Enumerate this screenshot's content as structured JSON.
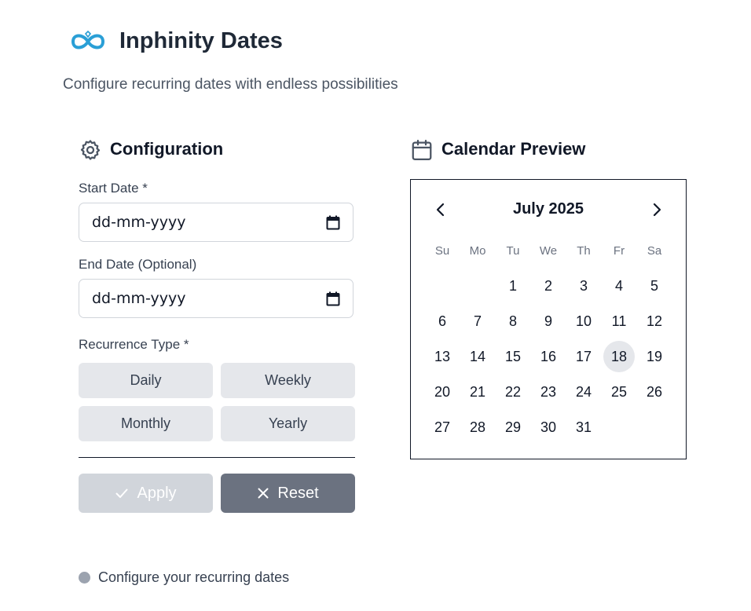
{
  "header": {
    "app_title": "Inphinity Dates",
    "subtitle": "Configure recurring dates with endless possibilities",
    "logo_icon": "infinity-logo-icon",
    "accent_color": "#2a9fd6"
  },
  "config": {
    "title": "Configuration",
    "icon": "gear-icon",
    "start_label": "Start Date *",
    "start_placeholder": "dd-mm-yyyy",
    "end_label": "End Date (Optional)",
    "end_placeholder": "dd-mm-yyyy",
    "recurrence_label": "Recurrence Type *",
    "recurrence_options": [
      "Daily",
      "Weekly",
      "Monthly",
      "Yearly"
    ],
    "apply_label": "Apply",
    "reset_label": "Reset"
  },
  "calendar": {
    "title": "Calendar Preview",
    "icon": "calendar-icon",
    "month_label": "July 2025",
    "weekdays": [
      "Su",
      "Mo",
      "Tu",
      "We",
      "Th",
      "Fr",
      "Sa"
    ],
    "first_weekday_index": 2,
    "days": [
      "1",
      "2",
      "3",
      "4",
      "5",
      "6",
      "7",
      "8",
      "9",
      "10",
      "11",
      "12",
      "13",
      "14",
      "15",
      "16",
      "17",
      "18",
      "19",
      "20",
      "21",
      "22",
      "23",
      "24",
      "25",
      "26",
      "27",
      "28",
      "29",
      "30",
      "31"
    ],
    "selected_day": "18"
  },
  "status": {
    "text": "Configure your recurring dates",
    "dot_color": "#9ca3af"
  }
}
